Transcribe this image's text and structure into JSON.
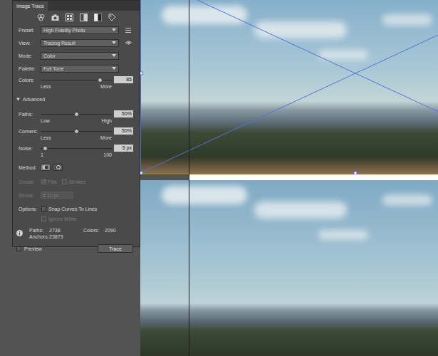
{
  "panel": {
    "title": "Image Trace",
    "dropdowns": [
      {
        "label": "Preset:",
        "value": "High Fidelity Photo",
        "kind": "menu"
      },
      {
        "label": "View:",
        "value": "Tracing Result",
        "kind": "eye"
      },
      {
        "label": "Mode:",
        "value": "Color",
        "kind": "plain"
      },
      {
        "label": "Palette:",
        "value": "Full Tone",
        "kind": "plain"
      }
    ],
    "colors": {
      "label": "Colors:",
      "level": 0.83,
      "value": "85",
      "min": "Less",
      "max": "More"
    },
    "advanced": {
      "label": "Advanced",
      "expanded": true
    },
    "sliders": [
      {
        "label": "Paths:",
        "level": 0.5,
        "value": "50%",
        "min": "Low",
        "max": "High"
      },
      {
        "label": "Corners:",
        "level": 0.5,
        "value": "50%",
        "min": "Less",
        "max": "More"
      },
      {
        "label": "Noise:",
        "level": 0.06,
        "value": "5 px",
        "min": "1",
        "max": "100"
      }
    ],
    "method": {
      "label": "Method:",
      "options": [
        {
          "selected": true
        },
        {
          "selected": false
        }
      ]
    },
    "create": {
      "label": "Create:",
      "disabled": true,
      "options": [
        {
          "label": "Fills",
          "checked": true
        },
        {
          "label": "Strokes",
          "checked": false
        }
      ]
    },
    "stroke": {
      "label": "Stroke:",
      "value": "10 px",
      "disabled": true
    },
    "options": {
      "label": "Options:",
      "items": [
        {
          "label": "Snap Curves To Lines",
          "checked": false,
          "disabled": false
        },
        {
          "label": "Ignore White",
          "checked": false,
          "disabled": true
        }
      ]
    },
    "stats": {
      "paths_label": "Paths:",
      "paths": "2738",
      "colors_label": "Colors:",
      "colors": "2090",
      "anchors_label": "Anchors:",
      "anchors": "23873"
    },
    "preview": {
      "label": "Preview",
      "checked": false
    },
    "button": "Trace"
  },
  "canvas": {
    "images": [
      {
        "selected": true
      },
      {
        "selected": false
      }
    ]
  }
}
